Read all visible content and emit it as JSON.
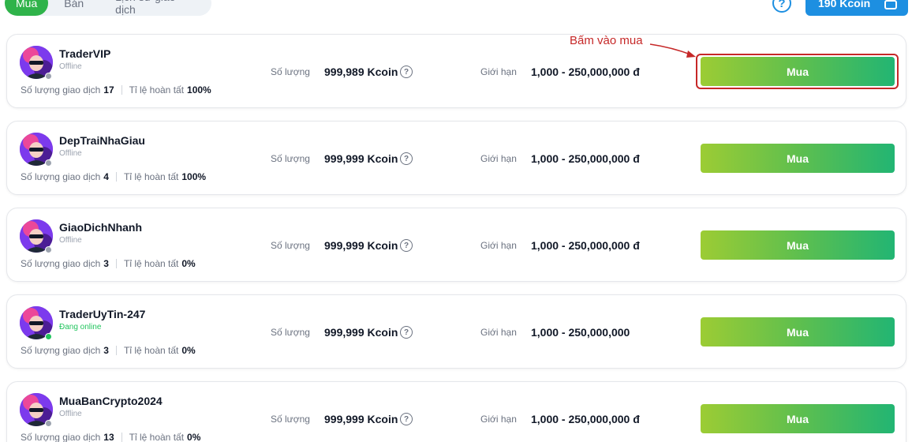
{
  "tabs": [
    {
      "label": "Mua",
      "active": true
    },
    {
      "label": "Bán",
      "active": false
    },
    {
      "label": "Lịch sử giao dịch",
      "active": false
    }
  ],
  "header": {
    "help_icon": "question-circle-icon",
    "wallet_label": "190 Kcoin",
    "wallet_icon": "wallet-icon"
  },
  "labels": {
    "quantity": "Số lượng",
    "limit": "Giới hạn",
    "trade_count": "Số lượng giao dịch",
    "completion_rate": "Tỉ lệ hoàn tất",
    "buy": "Mua"
  },
  "offers": [
    {
      "name": "TraderVIP",
      "status": "Offline",
      "online": false,
      "trades": "17",
      "completion": "100%",
      "quantity": "999,989 Kcoin",
      "limit": "1,000 - 250,000,000 đ"
    },
    {
      "name": "DepTraiNhaGiau",
      "status": "Offline",
      "online": false,
      "trades": "4",
      "completion": "100%",
      "quantity": "999,999 Kcoin",
      "limit": "1,000 - 250,000,000 đ"
    },
    {
      "name": "GiaoDichNhanh",
      "status": "Offline",
      "online": false,
      "trades": "3",
      "completion": "0%",
      "quantity": "999,999 Kcoin",
      "limit": "1,000 - 250,000,000 đ"
    },
    {
      "name": "TraderUyTin-247",
      "status": "Đang online",
      "online": true,
      "trades": "3",
      "completion": "0%",
      "quantity": "999,999 Kcoin",
      "limit": "1,000 - 250,000,000"
    },
    {
      "name": "MuaBanCrypto2024",
      "status": "Offline",
      "online": false,
      "trades": "13",
      "completion": "0%",
      "quantity": "999,999 Kcoin",
      "limit": "1,000 - 250,000,000 đ"
    }
  ],
  "annotation": {
    "text": "Bấm vào mua",
    "color": "#c62828"
  },
  "colors": {
    "accent_blue": "#1d8fe1",
    "tab_active": "#2fb34a",
    "buy_gradient_start": "#9ccc34",
    "buy_gradient_end": "#22b573",
    "online": "#22c55e"
  }
}
